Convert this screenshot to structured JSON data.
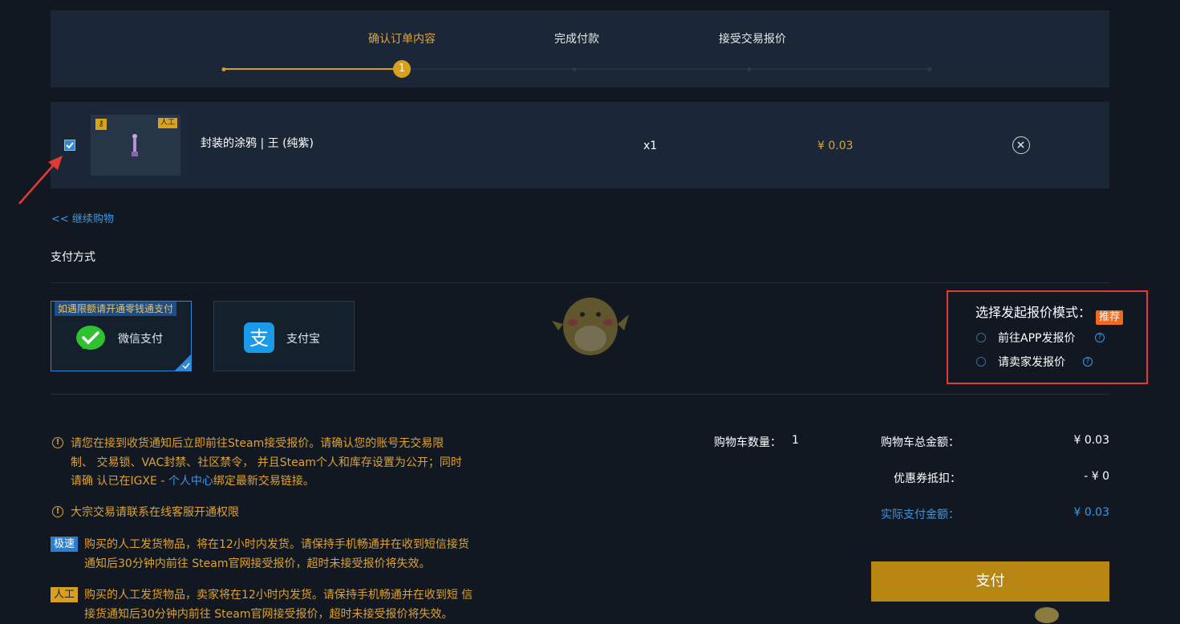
{
  "steps": {
    "items": [
      "确认订单内容",
      "完成付款",
      "接受交易报价"
    ],
    "current_number": "1"
  },
  "cart": {
    "item_name": "封装的涂鸦 | 王 (纯紫)",
    "badge_manual": "人工",
    "quantity": "x1",
    "price": "¥ 0.03",
    "checked": true
  },
  "continue_shopping": "<< 继续购物",
  "payment": {
    "title": "支付方式",
    "wechat_note": "如遇限额请开通零钱通支付",
    "wechat_label": "微信支付",
    "alipay_label": "支付宝"
  },
  "offer_mode": {
    "title": "选择发起报价模式：",
    "recommend": "推荐",
    "option_app": "前往APP发报价",
    "option_seller": "请卖家发报价"
  },
  "notices": {
    "steam_line1": "请您在接到收货通知后立即前往Steam接受报价。请确认您的账号无交易限",
    "steam_line2": "制、 交易锁、VAC封禁、社区禁令， 并且Steam个人和库存设置为公开；同时",
    "steam_line3_a": "请确 认已在IGXE - ",
    "steam_link": "个人中心",
    "steam_line3_b": "绑定最新交易链接。",
    "bulk": "大宗交易请联系在线客服开通权限",
    "fast_tag": "极速",
    "fast_line1": "购买的人工发货物品，将在12小时内发货。请保持手机畅通并在收到短信接货",
    "fast_line2": "通知后30分钟内前往 Steam官网接受报价，超时未接受报价将失效。",
    "manual_tag": "人工",
    "manual_line1": "购买的人工发货物品，卖家将在12小时内发货。请保持手机畅通并在收到短 信",
    "manual_line2": "接货通知后30分钟内前往 Steam官网接受报价，超时未接受报价将失效。"
  },
  "summary": {
    "count_label": "购物车数量：",
    "count_value": "1",
    "total_label": "购物车总金额：",
    "total_value": "¥ 0.03",
    "coupon_label": "优惠券抵扣：",
    "coupon_value": "- ¥ 0",
    "actual_label": "实际支付金额：",
    "actual_value": "¥  0.03",
    "pay_button": "支付"
  },
  "colors": {
    "accent_gold": "#d9a441",
    "link_blue": "#3a97e8",
    "highlight_red": "#e23a37",
    "pay_button": "#b78613"
  }
}
